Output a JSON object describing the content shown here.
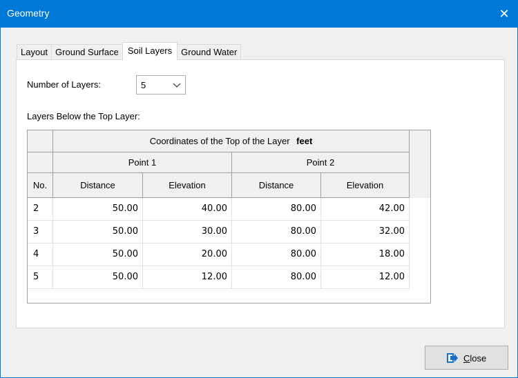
{
  "window": {
    "title": "Geometry",
    "close_glyph": "✕"
  },
  "tabs": [
    {
      "label": "Layout",
      "active": false
    },
    {
      "label": "Ground Surface",
      "active": false
    },
    {
      "label": "Soil Layers",
      "active": true
    },
    {
      "label": "Ground Water",
      "active": false
    }
  ],
  "layers": {
    "count_label": "Number of Layers:",
    "count_value": "5",
    "below_label": "Layers Below the Top Layer:"
  },
  "table": {
    "group_header": "Coordinates of the Top of the Layer",
    "unit": "feet",
    "point1": "Point 1",
    "point2": "Point 2",
    "col_no": "No.",
    "col_distance": "Distance",
    "col_elevation": "Elevation",
    "rows": [
      {
        "no": "2",
        "d1": "50.00",
        "e1": "40.00",
        "d2": "80.00",
        "e2": "42.00"
      },
      {
        "no": "3",
        "d1": "50.00",
        "e1": "30.00",
        "d2": "80.00",
        "e2": "32.00"
      },
      {
        "no": "4",
        "d1": "50.00",
        "e1": "20.00",
        "d2": "80.00",
        "e2": "18.00"
      },
      {
        "no": "5",
        "d1": "50.00",
        "e1": "12.00",
        "d2": "80.00",
        "e2": "12.00"
      }
    ]
  },
  "buttons": {
    "close_accel": "C",
    "close_rest": "lose"
  },
  "colors": {
    "titlebar": "#0078d7",
    "close_icon": "#1570c9"
  }
}
